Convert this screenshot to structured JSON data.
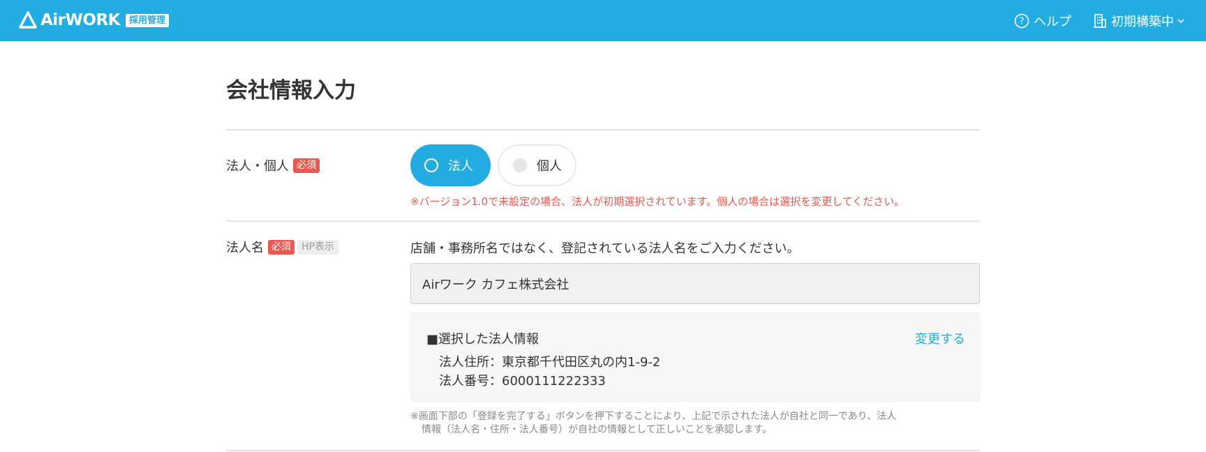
{
  "header": {
    "logo_text": "AirWORK",
    "logo_badge": "採用管理",
    "help_label": "ヘルプ",
    "shop_label": "初期構築中",
    "brand_color": "#23ace2"
  },
  "page": {
    "title": "会社情報入力"
  },
  "entity_type": {
    "label": "法人・個人",
    "required_badge": "必須",
    "options": [
      "法人",
      "個人"
    ],
    "selected": "法人",
    "warning": "※バージョン1.0で未設定の場合、法人が初期選択されています。個人の場合は選択を変更してください。"
  },
  "company_name": {
    "label": "法人名",
    "required_badge": "必須",
    "hp_badge": "HP表示",
    "help_text": "店舗・事務所名ではなく、登記されている法人名をご入力ください。",
    "value": "Airワーク カフェ株式会社"
  },
  "selected_info": {
    "title": "■選択した法人情報",
    "change_link": "変更する",
    "address_line": "法人住所：東京都千代田区丸の内1-9-2",
    "number_line": "法人番号：6000111222333"
  },
  "footnote": {
    "line1": "※画面下部の「登録を完了する」ボタンを押下することにより、上記で示された法人が自社と同一であり、法人",
    "line2": "情報（法人名・住所・法人番号）が自社の情報として正しいことを承認します。"
  },
  "colors": {
    "accent": "#23ace2",
    "required": "#e85a51"
  }
}
